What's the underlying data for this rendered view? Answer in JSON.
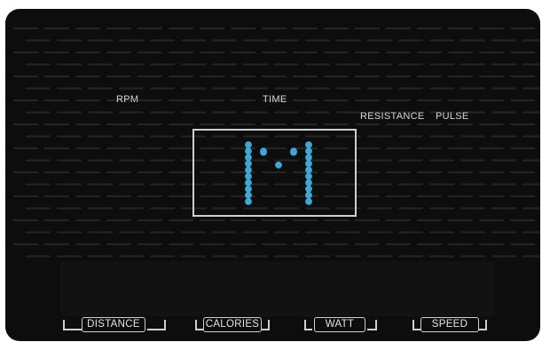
{
  "console": {
    "labels": {
      "rpm": "RPM",
      "time": "TIME",
      "resistance": "RESISTANCE",
      "pulse": "PULSE"
    },
    "display": {
      "character": "M",
      "dot_color": "#3fa7d6"
    },
    "buttons": {
      "distance": "DISTANCE",
      "calories": "CALORIES",
      "watt": "WATT",
      "speed": "SPEED"
    }
  }
}
